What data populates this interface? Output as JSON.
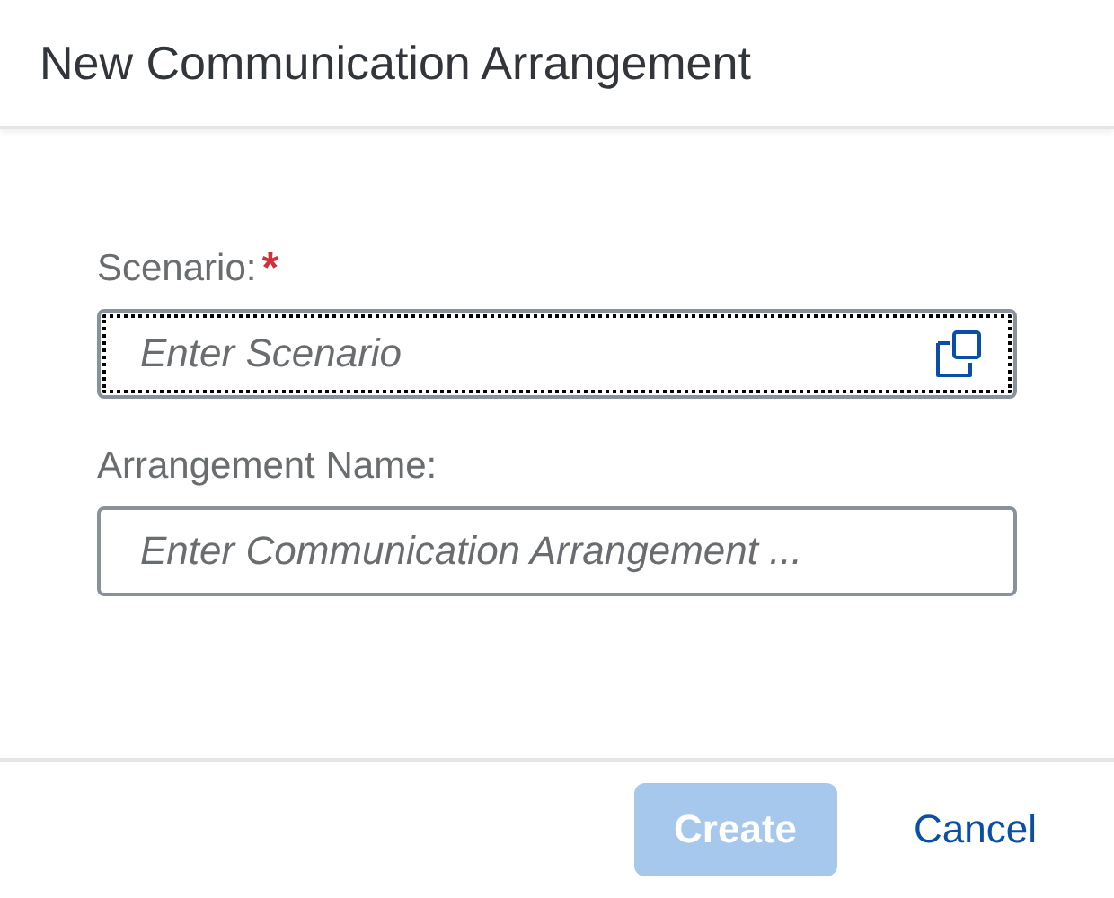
{
  "dialog": {
    "title": "New Communication Arrangement"
  },
  "fields": [
    {
      "label": "Scenario:",
      "required": true,
      "required_mark": "*",
      "placeholder": "Enter Scenario",
      "focused": true,
      "value_help": true
    },
    {
      "label": "Arrangement Name:",
      "required": false,
      "placeholder": "Enter Communication Arrangement ...",
      "focused": false,
      "value_help": false
    }
  ],
  "buttons": [
    {
      "label": "Create",
      "kind": "emphasized",
      "disabled": true
    },
    {
      "label": "Cancel",
      "kind": "transparent",
      "disabled": false
    }
  ]
}
